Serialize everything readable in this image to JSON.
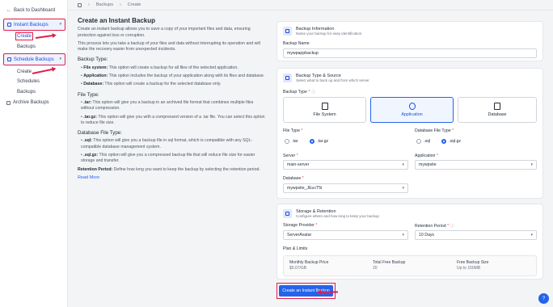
{
  "sidebar": {
    "back_label": "Back to Dashboard",
    "instant_group": "Instant Backups",
    "instant_items": [
      "Create",
      "Backups"
    ],
    "schedule_group": "Schedule Backups",
    "schedule_items": [
      "Create",
      "Schedules",
      "Backups"
    ],
    "archive_label": "Archive Backups"
  },
  "breadcrumb": {
    "items": [
      "Backups",
      "Create"
    ]
  },
  "info": {
    "title": "Create an Instant Backup",
    "intro": "Create an instant backup allows you to save a copy of your important files and data, ensuring protection against loss or corruption.",
    "intro2": "This process lets you take a backup of your files and data without interrupting its operation and will make the recovery easier from unexpected incidents.",
    "backup_type_heading": "Backup Type:",
    "bt1_label": "File system:",
    "bt1_text": " This option will create a backup for all files of the selected application.",
    "bt2_label": "Application:",
    "bt2_text": " This option includes the backup of your application along with its files and database.",
    "bt3_label": "Database:",
    "bt3_text": " This option will create a backup for the selected database only.",
    "file_type_heading": "File Type:",
    "ft1_label": ".tar:",
    "ft1_text": " This option will give you a backup in an archived file format that combines multiple files without compression.",
    "ft2_label": ".tar.gz:",
    "ft2_text": " This option will give you with a compressed version of a .tar file. You can select this option to reduce file size.",
    "db_type_heading": "Database File Type:",
    "dt1_label": ".sql:",
    "dt1_text": " This option will give you a backup file in sql format, which is compatible with any SQL-compatible database management system.",
    "dt2_label": ".sql.gz:",
    "dt2_text": " This option will give you a compressed backup file that will reduce file size for easier storage and transfer.",
    "retention_label": "Retention Period:",
    "retention_text": " Define how long you want to keep the backup by selecting the retention period.",
    "read_more": "Read More"
  },
  "backup_info": {
    "title": "Backup Information",
    "subtitle": "Name your backup for easy identification",
    "name_label": "Backup Name",
    "name_value": "mywpappbackup"
  },
  "type_source": {
    "title": "Backup Type & Source",
    "subtitle": "Select what to back up and from which server",
    "backup_type_label": "Backup Type",
    "types": [
      "File System",
      "Application",
      "Database"
    ],
    "selected_type": "Application",
    "file_type_label": "File Type",
    "file_types": [
      ".tar",
      ".tar.gz"
    ],
    "file_type_selected": ".tar.gz",
    "db_file_type_label": "Database File Type",
    "db_file_types": [
      ".sql",
      ".sql.gz"
    ],
    "db_file_type_selected": ".sql.gz",
    "server_label": "Server",
    "server_value": "main-server",
    "application_label": "Application",
    "application_value": "mywpsite",
    "database_label": "Database",
    "database_value": "mywpsite_JEucT5i"
  },
  "storage": {
    "title": "Storage & Retention",
    "subtitle": "Configure where and how long to keep your backup",
    "provider_label": "Storage Provider",
    "provider_value": "ServerAvatar",
    "retention_label": "Retention Period",
    "retention_value": "10 Days",
    "plan_heading": "Plan & Limits",
    "monthly_price_label": "Monthly Backup Price",
    "monthly_price_value": "$0.07/GB",
    "free_backup_label": "Total Free Backup",
    "free_backup_value": "20",
    "free_size_label": "Free Backup Size",
    "free_size_value": "Up to 150MB"
  },
  "cta_label": "Create an Instant Backup",
  "accent_color": "#2563eb",
  "highlight_color": "#e11d48"
}
